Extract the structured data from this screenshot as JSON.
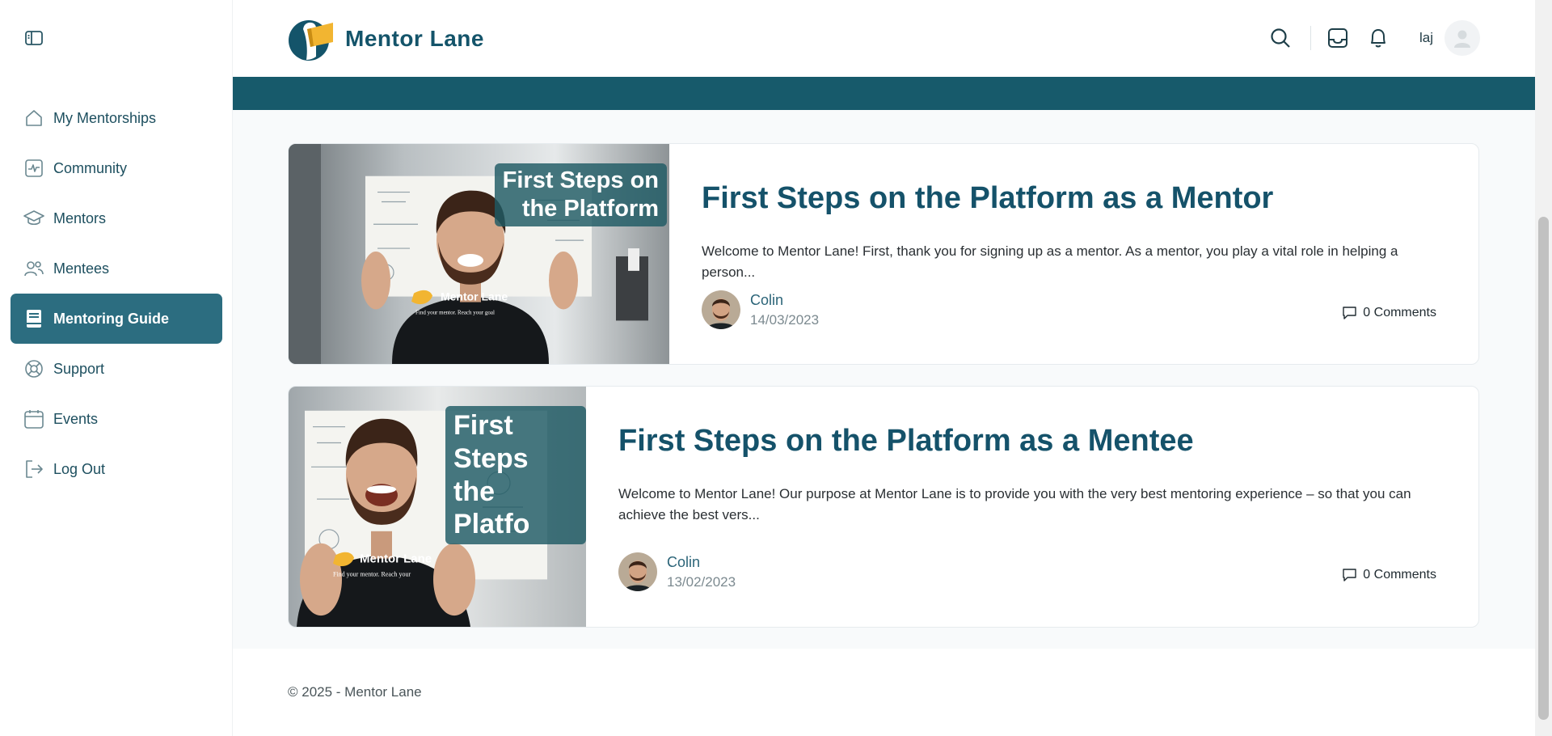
{
  "app": {
    "name": "Mentor Lane"
  },
  "sidebar": {
    "items": [
      {
        "label": "My Mentorships",
        "icon": "home-icon"
      },
      {
        "label": "Community",
        "icon": "activity-icon"
      },
      {
        "label": "Mentors",
        "icon": "graduation-cap-icon"
      },
      {
        "label": "Mentees",
        "icon": "users-icon"
      },
      {
        "label": "Mentoring Guide",
        "icon": "book-icon",
        "active": true
      },
      {
        "label": "Support",
        "icon": "lifebuoy-icon"
      },
      {
        "label": "Events",
        "icon": "calendar-icon"
      },
      {
        "label": "Log Out",
        "icon": "logout-icon"
      }
    ]
  },
  "header": {
    "user_initials": "laj"
  },
  "posts": [
    {
      "thumbnail_caption": "First Steps on\nthe Platform",
      "shirt_brand": "Mentor Lane",
      "shirt_tagline": "Find your mentor. Reach your goal",
      "title": "First Steps on the Platform as a Mentor",
      "excerpt": "Welcome to Mentor Lane! First, thank you for signing up as a mentor. As a mentor, you play a vital role in helping a person...",
      "author": "Colin",
      "date": "14/03/2023",
      "comments": "0 Comments"
    },
    {
      "thumbnail_caption": "First Steps\nthe Platfo",
      "shirt_brand": "Mentor Lane",
      "shirt_tagline": "Find your mentor. Reach your",
      "title": "First Steps on the Platform as a Mentee",
      "excerpt": "Welcome to Mentor Lane! Our purpose at Mentor Lane is to provide you with the very best mentoring experience – so that you can achieve the best vers...",
      "author": "Colin",
      "date": "13/02/2023",
      "comments": "0 Comments"
    }
  ],
  "footer": {
    "text": "© 2025 - Mentor Lane"
  },
  "colors": {
    "brand": "#14546a",
    "active_nav": "#2c6d80",
    "banner": "#175a6b",
    "logo_yellow": "#f2b531"
  }
}
